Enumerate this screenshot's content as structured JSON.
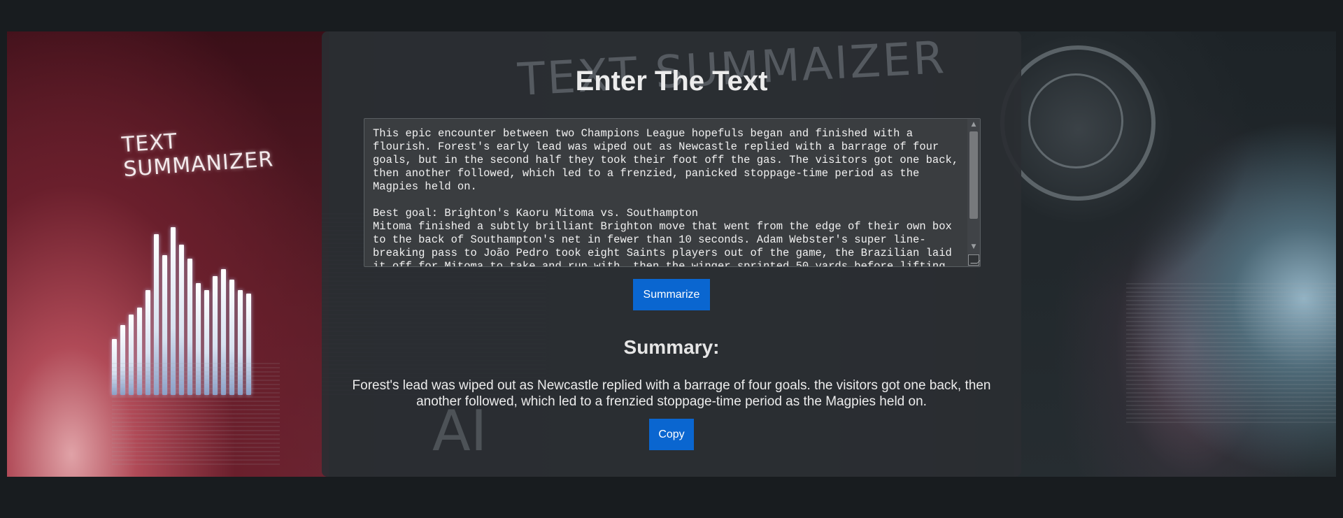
{
  "background": {
    "left_panel_title": "TEXT SUMMANIZER",
    "center_watermark": "TEXT SUMMAIZER",
    "center_ai_mark": "AI",
    "accent_color": "#0a66d0"
  },
  "main": {
    "title": "Enter The Text",
    "input_text": "This epic encounter between two Champions League hopefuls began and finished with a flourish. Forest's early lead was wiped out as Newcastle replied with a barrage of four goals, but in the second half they took their foot off the gas. The visitors got one back, then another followed, which led to a frenzied, panicked stoppage-time period as the Magpies held on.\n\nBest goal: Brighton's Kaoru Mitoma vs. Southampton\nMitoma finished a subtly brilliant Brighton move that went from the edge of their own box to the back of Southampton's net in fewer than 10 seconds. Adam Webster's super line-breaking pass to João Pedro took eight Saints players out of the game, the Brazilian laid it off for Mitoma to take and run with, then the winger sprinted 50 yards before lifting",
    "summarize_button": "Summarize",
    "summary_heading": "Summary:",
    "summary_text": "Forest's lead was wiped out as Newcastle replied with a barrage of four goals. the visitors got one back, then another followed, which led to a frenzied stoppage-time period as the Magpies held on.",
    "copy_button": "Copy"
  }
}
